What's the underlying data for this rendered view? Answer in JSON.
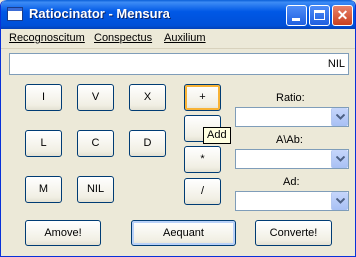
{
  "window": {
    "title": "Ratiocinator - Mensura"
  },
  "menu": {
    "items": [
      "Recognoscitum",
      "Conspectus",
      "Auxilium"
    ]
  },
  "display": {
    "value": "NIL"
  },
  "numeral_buttons": [
    "I",
    "V",
    "X",
    "L",
    "C",
    "D",
    "M",
    "NIL"
  ],
  "operator_buttons": [
    "+",
    "",
    "*",
    "/"
  ],
  "tooltip": {
    "text": "Add"
  },
  "fields": {
    "ratio_label": "Ratio:",
    "a_ab_label": "A\\Ab:",
    "ad_label": "Ad:"
  },
  "bottom_buttons": {
    "amove": "Amove!",
    "aequant": "Aequant",
    "converte": "Converte!"
  },
  "colors": {
    "titlebar": "#0058e6",
    "window_bg": "#ece9d8",
    "button_border": "#003c74",
    "tooltip_bg": "#ffffe1"
  }
}
